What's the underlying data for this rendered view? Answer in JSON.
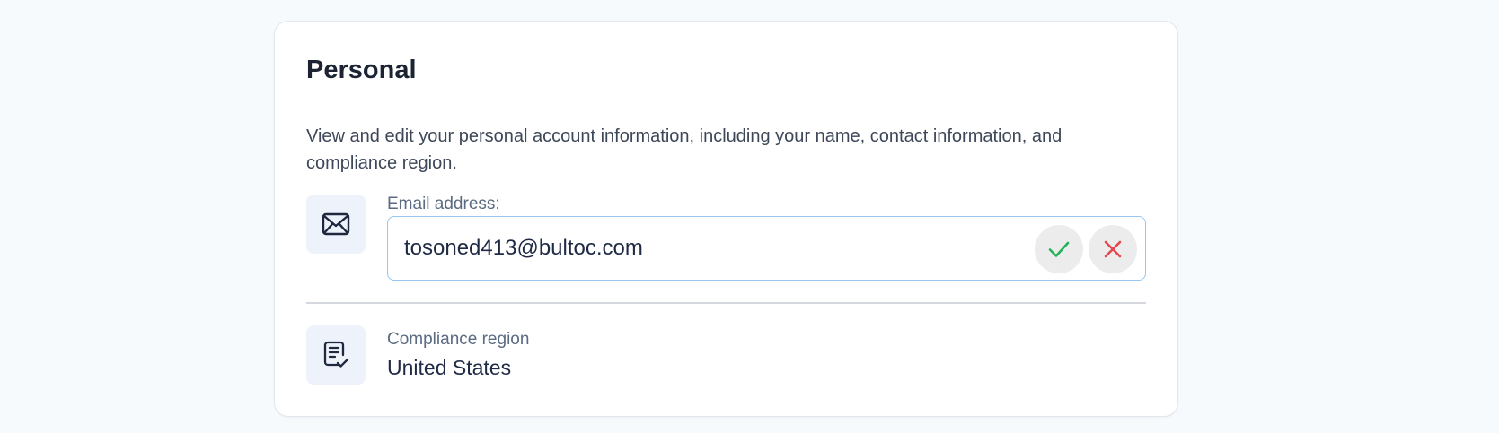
{
  "section": {
    "title": "Personal",
    "description": "View and edit your personal account information, including your name, contact information, and compliance region."
  },
  "email": {
    "label": "Email address:",
    "value": "tosoned413@bultoc.com",
    "icon": "envelope-icon",
    "confirm_icon": "check-icon",
    "cancel_icon": "close-icon"
  },
  "region": {
    "label": "Compliance region",
    "value": "United States",
    "icon": "document-check-icon"
  },
  "colors": {
    "page_background": "#f6fafd",
    "card_background": "#ffffff",
    "icon_background": "#eef3fb",
    "input_border": "#97c6f0",
    "confirm": "#22b357",
    "cancel": "#e5484d"
  }
}
